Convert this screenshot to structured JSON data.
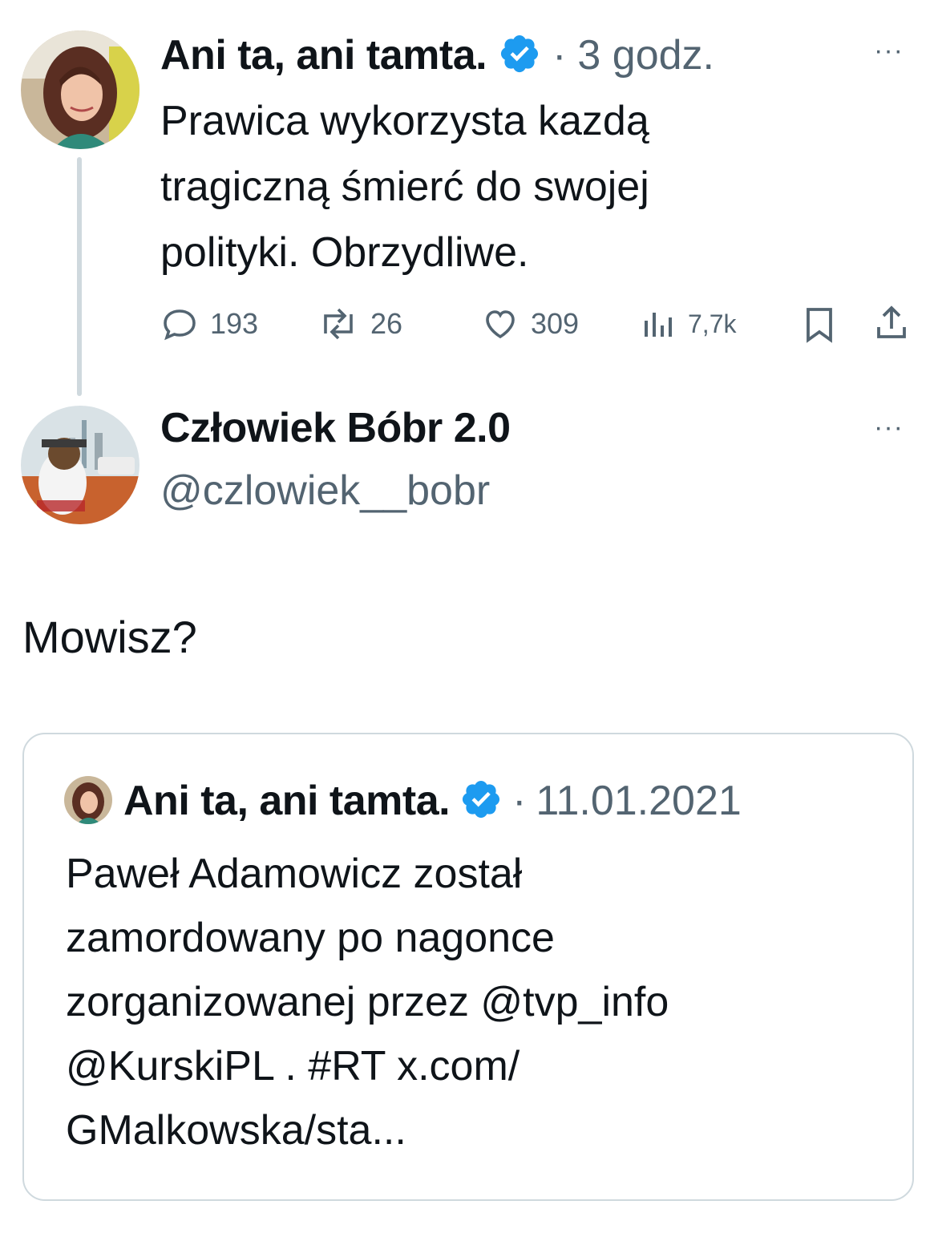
{
  "tweet": {
    "author_name": "Ani ta, ani tamta.",
    "separator": "·",
    "time": "3 godz.",
    "more_label": "···",
    "text": "Prawica wykorzysta kazdą\ntragiczną  śmierć do swojej\npolityki. Obrzydliwe.",
    "actions": {
      "replies": "193",
      "retweets": "26",
      "likes": "309",
      "views": "7,7k"
    },
    "icons": [
      "reply-icon",
      "retweet-icon",
      "like-icon",
      "views-icon",
      "bookmark-icon",
      "share-icon",
      "verified-badge-icon"
    ]
  },
  "reply": {
    "author_name": "Człowiek Bóbr 2.0",
    "handle": "@czlowiek__bobr",
    "more_label": "···",
    "text": "Mowisz?"
  },
  "quote": {
    "author_name": "Ani ta, ani tamta.",
    "separator": "·",
    "date": "11.01.2021",
    "text": "Paweł Adamowicz został\nzamordowany po nagonce\nzorganizowanej przez @tvp_info\n@KurskiPL . #RT x.com/\nGMalkowska/sta..."
  },
  "colors": {
    "verified_blue": "#1d9bf0",
    "muted": "#536471",
    "text": "#0f1419",
    "border": "#cfd9de"
  }
}
